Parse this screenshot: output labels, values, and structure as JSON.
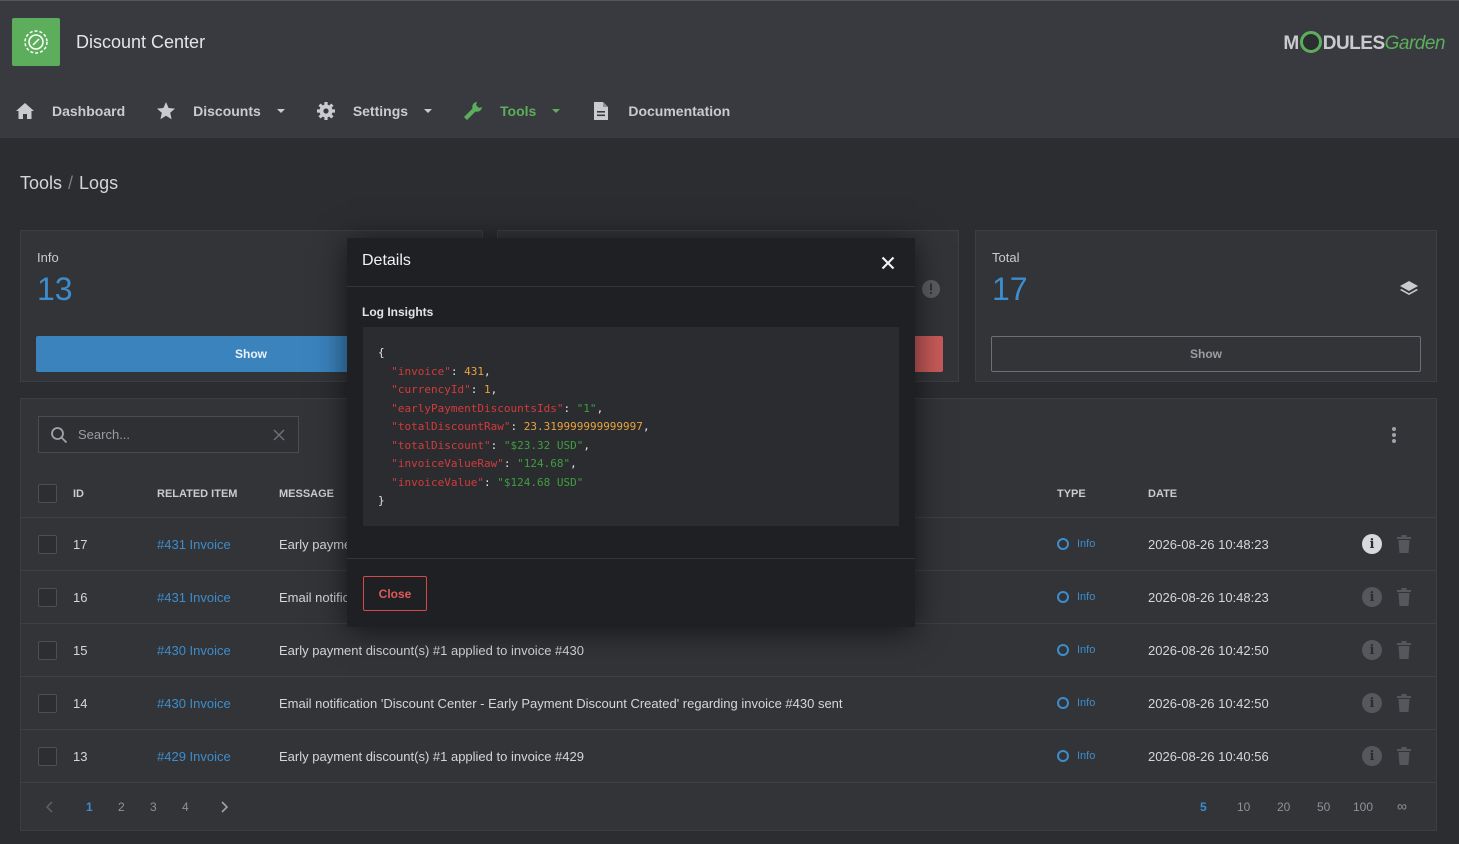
{
  "app": {
    "title": "Discount Center",
    "brand_left": "M",
    "brand_mid": "DULES",
    "brand_right": "Garden"
  },
  "nav": [
    {
      "label": "Dashboard",
      "icon": "home-icon"
    },
    {
      "label": "Discounts",
      "icon": "star-icon"
    },
    {
      "label": "Settings",
      "icon": "gear-icon"
    },
    {
      "label": "Tools",
      "icon": "wrench-icon",
      "active": true
    },
    {
      "label": "Documentation",
      "icon": "document-icon"
    }
  ],
  "breadcrumb": {
    "parent": "Tools",
    "separator": "/",
    "current": "Logs"
  },
  "cards": {
    "info": {
      "label": "Info",
      "value": "13",
      "button": "Show"
    },
    "total": {
      "label": "Total",
      "value": "17",
      "button": "Show"
    }
  },
  "search": {
    "placeholder": "Search..."
  },
  "table": {
    "headers": {
      "id": "ID",
      "related": "RELATED ITEM",
      "message": "MESSAGE",
      "type": "TYPE",
      "date": "DATE"
    },
    "rows": [
      {
        "id": "17",
        "related": "#431 Invoice",
        "message": "Early payme",
        "type": "Info",
        "date": "2026-08-26 10:48:23"
      },
      {
        "id": "16",
        "related": "#431 Invoice",
        "message": "Email notific",
        "type": "Info",
        "date": "2026-08-26 10:48:23"
      },
      {
        "id": "15",
        "related": "#430 Invoice",
        "message": "Early payment discount(s) #1 applied to invoice #430",
        "type": "Info",
        "date": "2026-08-26 10:42:50"
      },
      {
        "id": "14",
        "related": "#430 Invoice",
        "message": "Email notification 'Discount Center - Early Payment Discount Created' regarding invoice #430 sent",
        "type": "Info",
        "date": "2026-08-26 10:42:50"
      },
      {
        "id": "13",
        "related": "#429 Invoice",
        "message": "Early payment discount(s) #1 applied to invoice #429",
        "type": "Info",
        "date": "2026-08-26 10:40:56"
      }
    ]
  },
  "pagination": {
    "pages": [
      "1",
      "2",
      "3",
      "4"
    ],
    "current_page": "1",
    "sizes": [
      "5",
      "10",
      "20",
      "50",
      "100",
      "∞"
    ],
    "current_size": "5"
  },
  "modal": {
    "title": "Details",
    "section": "Log Insights",
    "json": [
      {
        "key": "\"invoice\"",
        "value": "431",
        "kind": "n"
      },
      {
        "key": "\"currencyId\"",
        "value": "1",
        "kind": "n"
      },
      {
        "key": "\"earlyPaymentDiscountsIds\"",
        "value": "\"1\"",
        "kind": "s"
      },
      {
        "key": "\"totalDiscountRaw\"",
        "value": "23.319999999999997",
        "kind": "n"
      },
      {
        "key": "\"totalDiscount\"",
        "value": "\"$23.32 USD\"",
        "kind": "s"
      },
      {
        "key": "\"invoiceValueRaw\"",
        "value": "\"124.68\"",
        "kind": "s"
      },
      {
        "key": "\"invoiceValue\"",
        "value": "\"$124.68 USD\"",
        "kind": "s"
      }
    ],
    "close_label": "Close"
  },
  "colors": {
    "accent": "#5cae5c",
    "link": "#3d8dcc",
    "danger": "#d44a4a"
  }
}
